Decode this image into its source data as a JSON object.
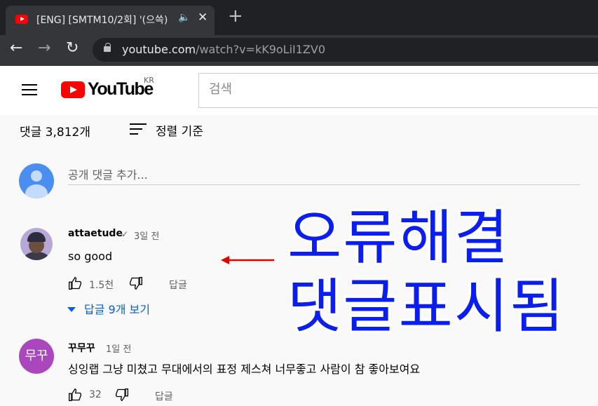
{
  "browser": {
    "tab_title": "[ENG] [SMTM10/2회] '(으쓱)",
    "audio_icon": "speaker-icon",
    "close_icon": "close-icon",
    "new_tab": "+",
    "url_host": "youtube.com",
    "url_path": "/watch?v=kK9oLiI1ZV0"
  },
  "header": {
    "logo_text": "YouTube",
    "region": "KR",
    "search_placeholder": "검색"
  },
  "comments": {
    "count_label": "댓글 3,812개",
    "sort_label": "정렬 기준",
    "add_placeholder": "공개 댓글 추가...",
    "items": [
      {
        "author": "attaetude",
        "verified_mark": "✓",
        "time": "3일 전",
        "text": "so good",
        "likes": "1.5천",
        "reply_label": "답글",
        "replies_toggle": "답글 9개 보기"
      },
      {
        "author": "꾸무꾸",
        "avatar_text": "무꾸",
        "time": "1일 전",
        "text": "싱잉랩 그냥 미쳤고 무대에서의 표정 제스쳐 너무좋고 사람이 참 좋아보여요",
        "likes": "32",
        "reply_label": "답글"
      }
    ]
  },
  "overlay": {
    "line1": "오류해결",
    "line2": "댓글표시됨",
    "text_color": "#0a1ef0",
    "arrow_color": "#e00000"
  },
  "colors": {
    "link_blue": "#065fd4",
    "yt_red": "#ff0000",
    "avatar_purple": "#ab47bc"
  }
}
